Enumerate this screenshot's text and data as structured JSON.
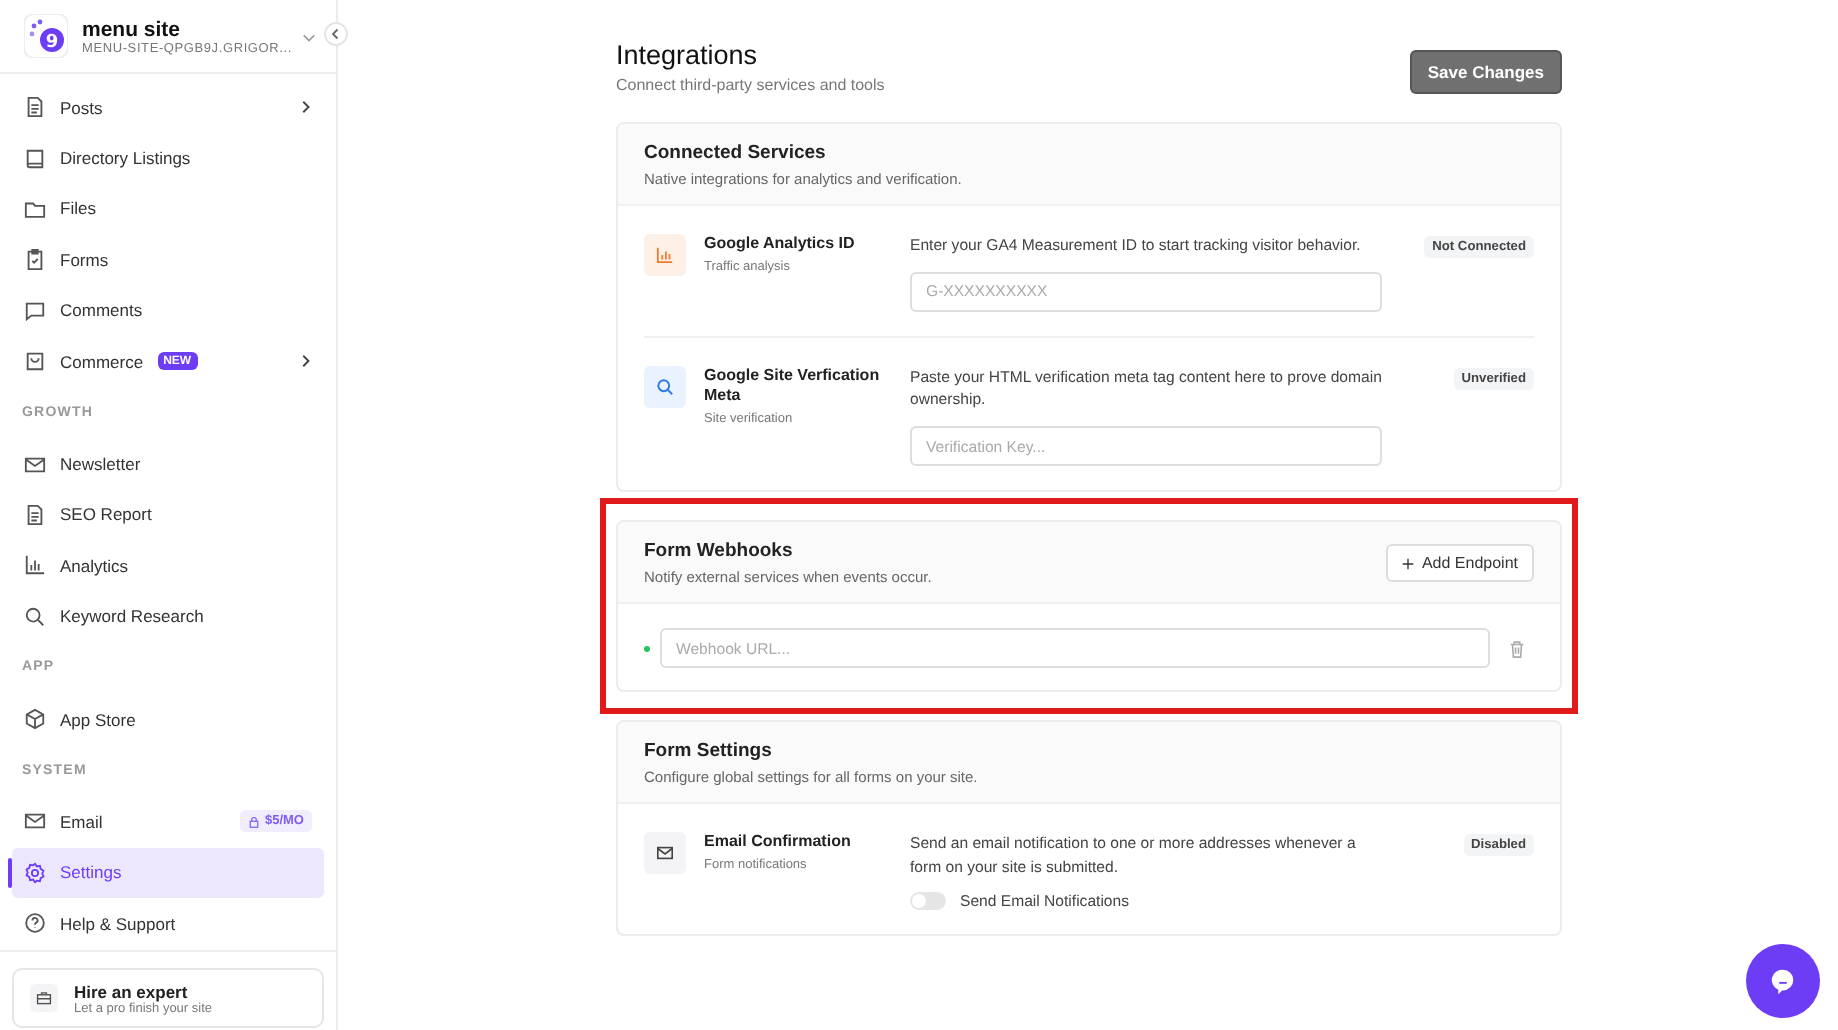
{
  "sidebar": {
    "logo_text": "9",
    "site_name": "menu site",
    "site_url": "MENU-SITE-QPGB9J.GRIGOR...",
    "sections": [
      {
        "items": [
          {
            "label": "Posts",
            "expandable": true,
            "selected": false
          },
          {
            "label": "Directory Listings",
            "expandable": false,
            "selected": false
          },
          {
            "label": "Files",
            "expandable": false,
            "selected": false
          },
          {
            "label": "Forms",
            "expandable": false,
            "selected": false
          },
          {
            "label": "Comments",
            "expandable": false,
            "selected": false
          },
          {
            "label": "Commerce",
            "tag": {
              "kind": "new",
              "text": "NEW"
            },
            "expandable": true,
            "selected": false
          }
        ]
      },
      {
        "heading": "GROWTH",
        "items": [
          {
            "label": "Newsletter",
            "expandable": false,
            "selected": false
          },
          {
            "label": "SEO Report",
            "expandable": false,
            "selected": false
          },
          {
            "label": "Analytics",
            "expandable": false,
            "selected": false
          },
          {
            "label": "Keyword Research",
            "expandable": false,
            "selected": false
          }
        ]
      },
      {
        "heading": "APP",
        "items": [
          {
            "label": "App Store",
            "expandable": false,
            "selected": false
          }
        ]
      },
      {
        "heading": "SYSTEM",
        "items": [
          {
            "label": "Email",
            "tag": {
              "kind": "locked",
              "text": "$5/MO"
            },
            "expandable": false,
            "selected": false
          },
          {
            "label": "Settings",
            "expandable": false,
            "selected": true
          },
          {
            "label": "Help & Support",
            "expandable": false,
            "selected": false
          }
        ]
      }
    ],
    "footer": {
      "title": "Hire an expert",
      "subtitle": "Let a pro finish your site"
    }
  },
  "page": {
    "title": "Integrations",
    "subtitle": "Connect third-party services and tools",
    "save_button": "Save Changes"
  },
  "connected_services": {
    "title": "Connected Services",
    "subtitle": "Native integrations for analytics and verification.",
    "services": [
      {
        "name": "Google Analytics ID",
        "subtitle": "Traffic analysis",
        "description": "Enter your GA4 Measurement ID to start tracking visitor behavior.",
        "placeholder": "G-XXXXXXXXXX",
        "status": "Not Connected"
      },
      {
        "name": "Google Site Verfication Meta",
        "subtitle": "Site verification",
        "description": "Paste your HTML verification meta tag content here to prove domain ownership.",
        "placeholder": "Verification Key...",
        "status": "Unverified"
      }
    ]
  },
  "form_webhooks": {
    "title": "Form Webhooks",
    "subtitle": "Notify external services when events occur.",
    "add_button": "Add Endpoint",
    "highlighted": true,
    "endpoints": [
      {
        "placeholder": "Webhook URL...",
        "active": true
      }
    ]
  },
  "form_settings": {
    "title": "Form Settings",
    "subtitle": "Configure global settings for all forms on your site.",
    "settings": [
      {
        "name": "Email Confirmation",
        "subtitle": "Form notifications",
        "description": "Send an email notification to one or more addresses whenever a form on your site is submitted.",
        "status": "Disabled",
        "toggle": {
          "label": "Send Email Notifications",
          "on": false
        }
      }
    ]
  }
}
